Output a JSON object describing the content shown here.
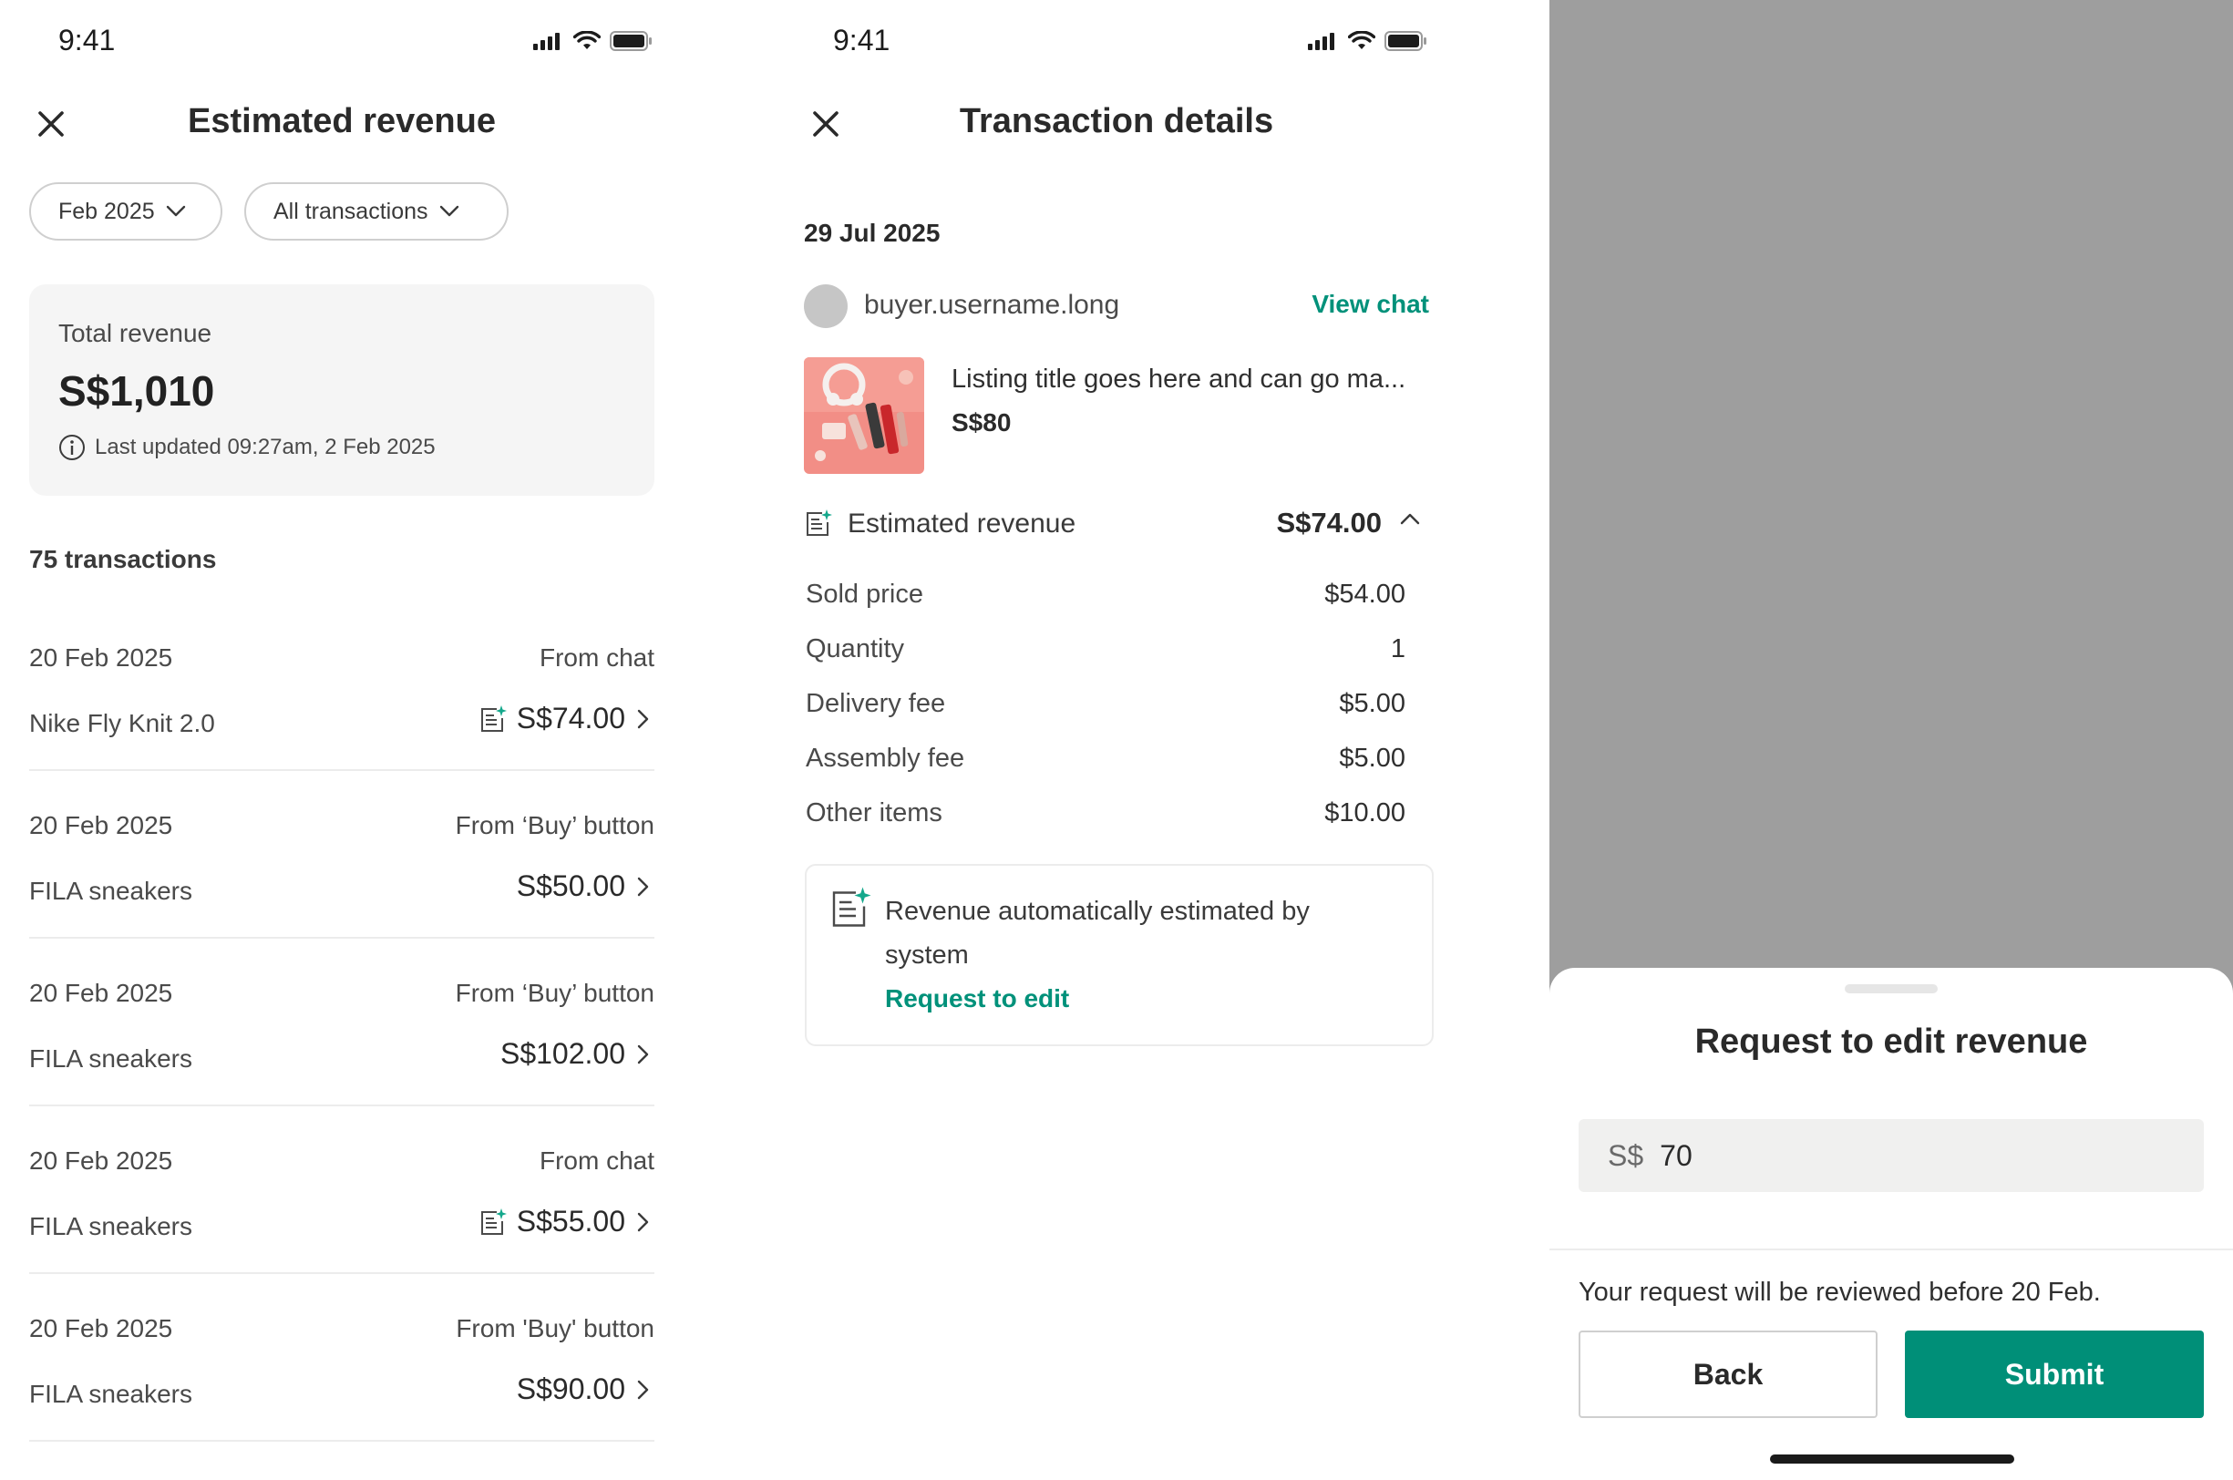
{
  "status_bar": {
    "time": "9:41"
  },
  "screen1": {
    "title": "Estimated revenue",
    "filters": [
      {
        "label": "Feb 2025"
      },
      {
        "label": "All transactions"
      }
    ],
    "summary": {
      "label": "Total revenue",
      "amount": "S$1,010",
      "updated": "Last updated 09:27am, 2 Feb 2025"
    },
    "transaction_count": "75 transactions",
    "transactions": [
      {
        "date": "20 Feb 2025",
        "source": "From chat",
        "item": "Nike Fly Knit 2.0",
        "amount": "S$74.00",
        "estimated": true
      },
      {
        "date": "20 Feb 2025",
        "source": "From ‘Buy’ button",
        "item": "FILA sneakers",
        "amount": "S$50.00",
        "estimated": false
      },
      {
        "date": "20 Feb 2025",
        "source": "From ‘Buy’ button",
        "item": "FILA sneakers",
        "amount": "S$102.00",
        "estimated": false
      },
      {
        "date": "20 Feb 2025",
        "source": "From chat",
        "item": "FILA sneakers",
        "amount": "S$55.00",
        "estimated": true
      },
      {
        "date": "20 Feb 2025",
        "source": "From 'Buy' button",
        "item": "FILA sneakers",
        "amount": "S$90.00",
        "estimated": false
      }
    ]
  },
  "screen2": {
    "title": "Transaction details",
    "date": "29 Jul 2025",
    "buyer": "buyer.username.long",
    "view_chat": "View chat",
    "listing": {
      "title": "Listing title goes here and can go ma...",
      "price": "S$80"
    },
    "estimated": {
      "label": "Estimated revenue",
      "amount": "S$74.00"
    },
    "breakdown": [
      {
        "label": "Sold price",
        "value": "$54.00"
      },
      {
        "label": "Quantity",
        "value": "1"
      },
      {
        "label": "Delivery fee",
        "value": "$5.00"
      },
      {
        "label": "Assembly fee",
        "value": "$5.00"
      },
      {
        "label": "Other items",
        "value": "$10.00"
      }
    ],
    "notice": {
      "text": "Revenue automatically estimated by system",
      "link": "Request to edit"
    }
  },
  "screen3": {
    "title": "Request to edit revenue",
    "currency": "S$",
    "amount_value": "70",
    "note": "Your request will be reviewed before 20 Feb.",
    "back": "Back",
    "submit": "Submit"
  },
  "colors": {
    "accent": "#008f78",
    "link": "#00917a",
    "overlay": "#9e9e9e",
    "card": "#f5f5f5"
  },
  "icons": [
    "close-icon",
    "chevron-down-icon",
    "chevron-right-icon",
    "chevron-up-icon",
    "info-icon",
    "ai-estimate-icon",
    "signal-icon",
    "wifi-icon",
    "battery-icon"
  ]
}
